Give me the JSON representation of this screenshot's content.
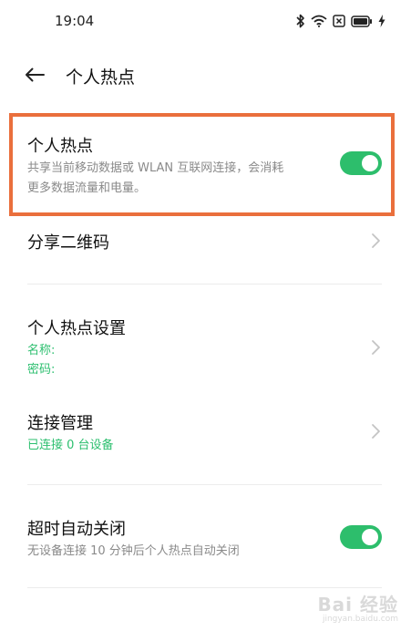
{
  "status_bar": {
    "time": "19:04",
    "icons": [
      "bluetooth-icon",
      "wifi-icon",
      "sim-blocked-icon",
      "battery-icon",
      "charging-icon"
    ]
  },
  "header": {
    "title": "个人热点",
    "back_icon": "arrow-left-icon"
  },
  "hotspot": {
    "title": "个人热点",
    "description_line1": "共享当前移动数据或 WLAN 互联网连接，会消耗",
    "description_line2": "更多数据流量和电量。",
    "enabled": true
  },
  "share_qr": {
    "title": "分享二维码"
  },
  "hotspot_settings": {
    "title": "个人热点设置",
    "name_label": "名称:",
    "password_label": "密码:"
  },
  "connection_management": {
    "title": "连接管理",
    "status": "已连接 0 台设备"
  },
  "auto_off": {
    "title": "超时自动关闭",
    "description": "无设备连接 10 分钟后个人热点自动关闭",
    "enabled": true
  },
  "watermark": {
    "main": "Bai 经验",
    "sub": "jingyan.baidu.com"
  },
  "colors": {
    "accent_green": "#2dbe6c",
    "highlight_orange": "#ea6f3c"
  }
}
